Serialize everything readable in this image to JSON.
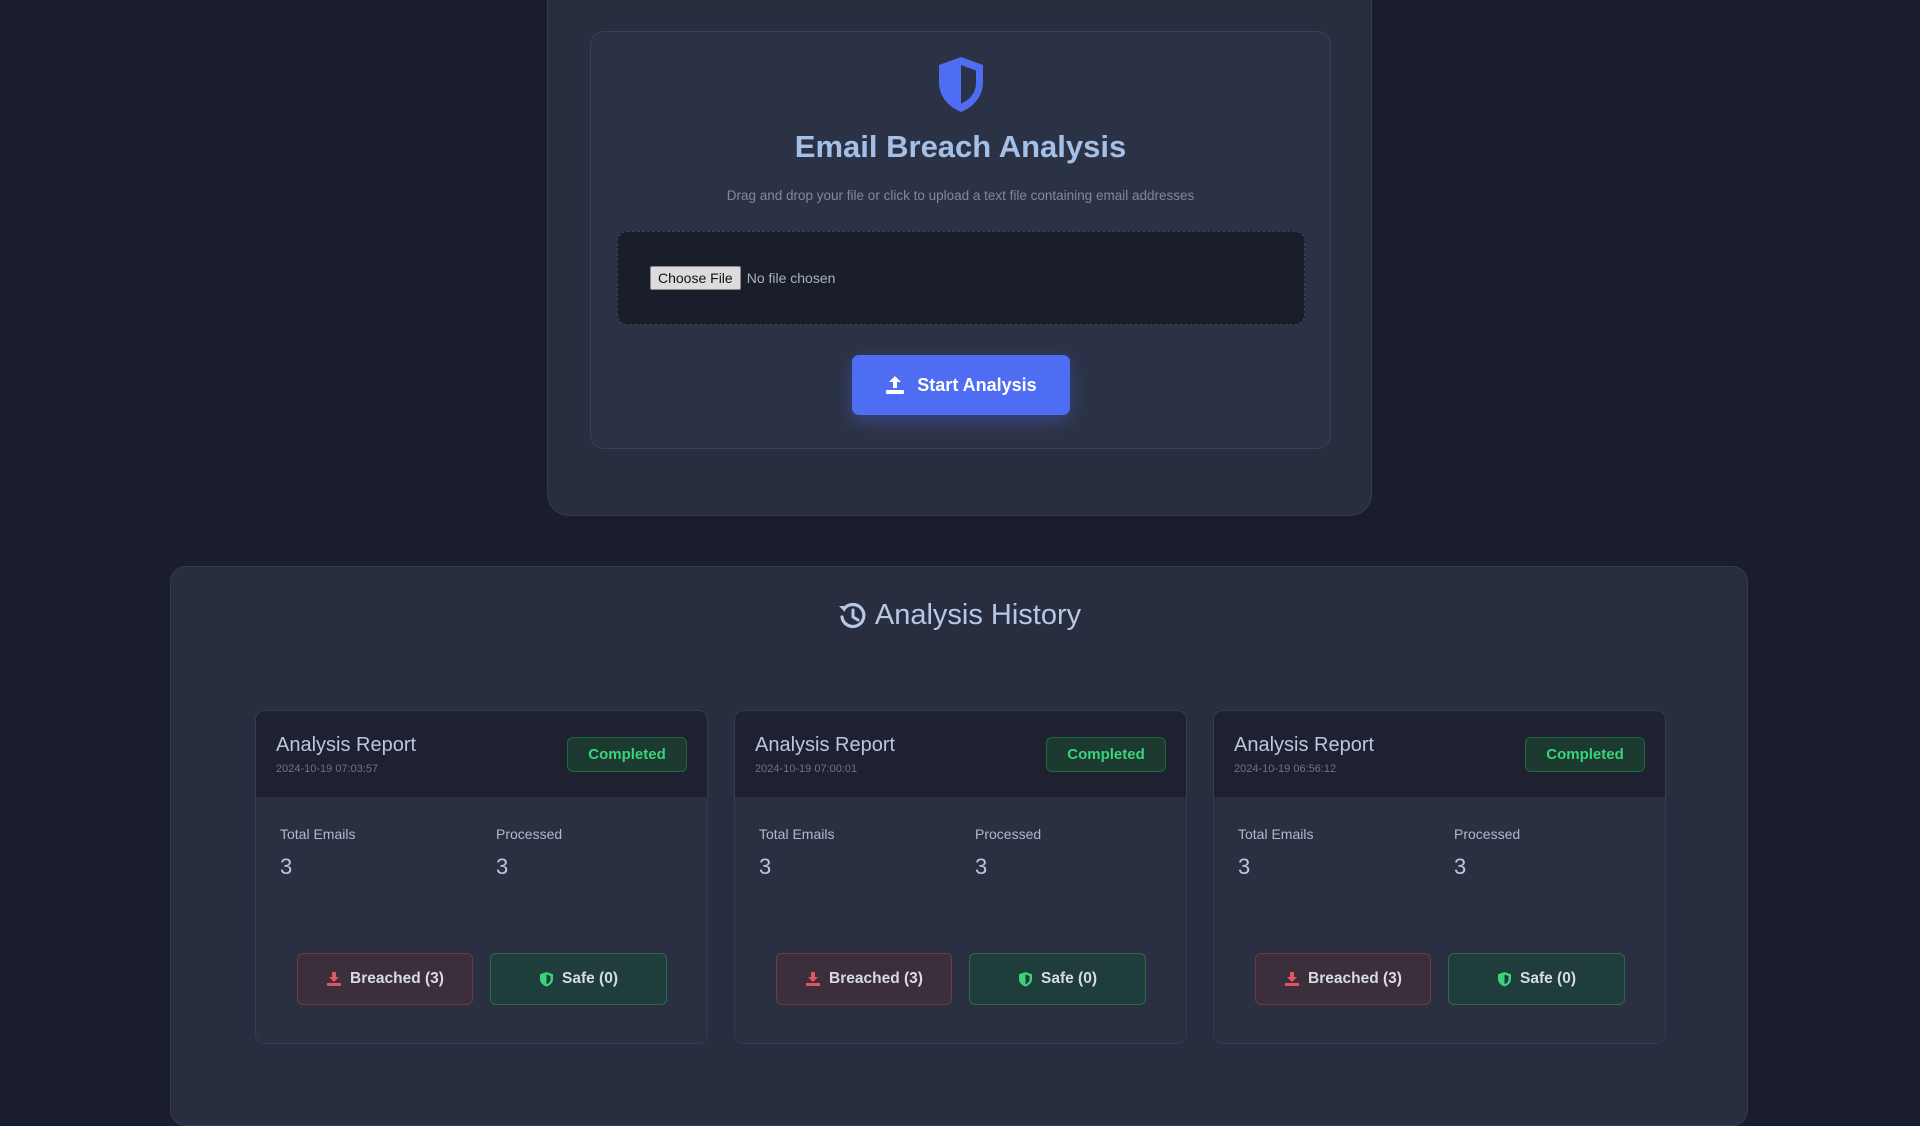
{
  "upload": {
    "title": "Email Breach Analysis",
    "subtitle": "Drag and drop your file or click to upload a text file containing email addresses",
    "choose_file_label": "Choose File",
    "file_status": "No file chosen",
    "start_button_label": "Start Analysis",
    "icon": "shield-icon",
    "start_icon": "upload-icon"
  },
  "history": {
    "title": "Analysis History",
    "icon": "history-icon",
    "reports": [
      {
        "title": "Analysis Report",
        "timestamp": "2024-10-19 07:03:57",
        "status": "Completed",
        "total_label": "Total Emails",
        "total_value": "3",
        "processed_label": "Processed",
        "processed_value": "3",
        "breached_label": "Breached (3)",
        "safe_label": "Safe (0)"
      },
      {
        "title": "Analysis Report",
        "timestamp": "2024-10-19 07:00:01",
        "status": "Completed",
        "total_label": "Total Emails",
        "total_value": "3",
        "processed_label": "Processed",
        "processed_value": "3",
        "breached_label": "Breached (3)",
        "safe_label": "Safe (0)"
      },
      {
        "title": "Analysis Report",
        "timestamp": "2024-10-19 06:56:12",
        "status": "Completed",
        "total_label": "Total Emails",
        "total_value": "3",
        "processed_label": "Processed",
        "processed_value": "3",
        "breached_label": "Breached (3)",
        "safe_label": "Safe (0)"
      }
    ]
  },
  "colors": {
    "background": "#1a1d2e",
    "panel": "#282d40",
    "accent": "#4f6df2",
    "success": "#3ad37a",
    "danger": "#e25563"
  }
}
